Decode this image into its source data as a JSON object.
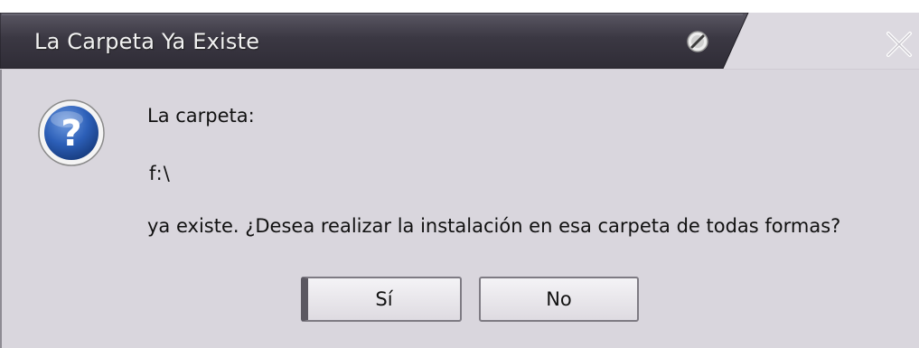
{
  "window": {
    "title": "La Carpeta Ya Existe"
  },
  "message": {
    "line1": "La carpeta:",
    "path": "f:\\",
    "line3": "ya existe. ¿Desea realizar la instalación en esa carpeta de todas formas?"
  },
  "buttons": {
    "yes_label": "Sí",
    "no_label": "No"
  },
  "icons": {
    "title_pin": "pin-icon",
    "close": "close-icon",
    "message": "question-icon"
  },
  "colors": {
    "titlebar": "#3c3944",
    "window_background": "#d9d6dd",
    "question_icon": "#1f4fa3"
  }
}
